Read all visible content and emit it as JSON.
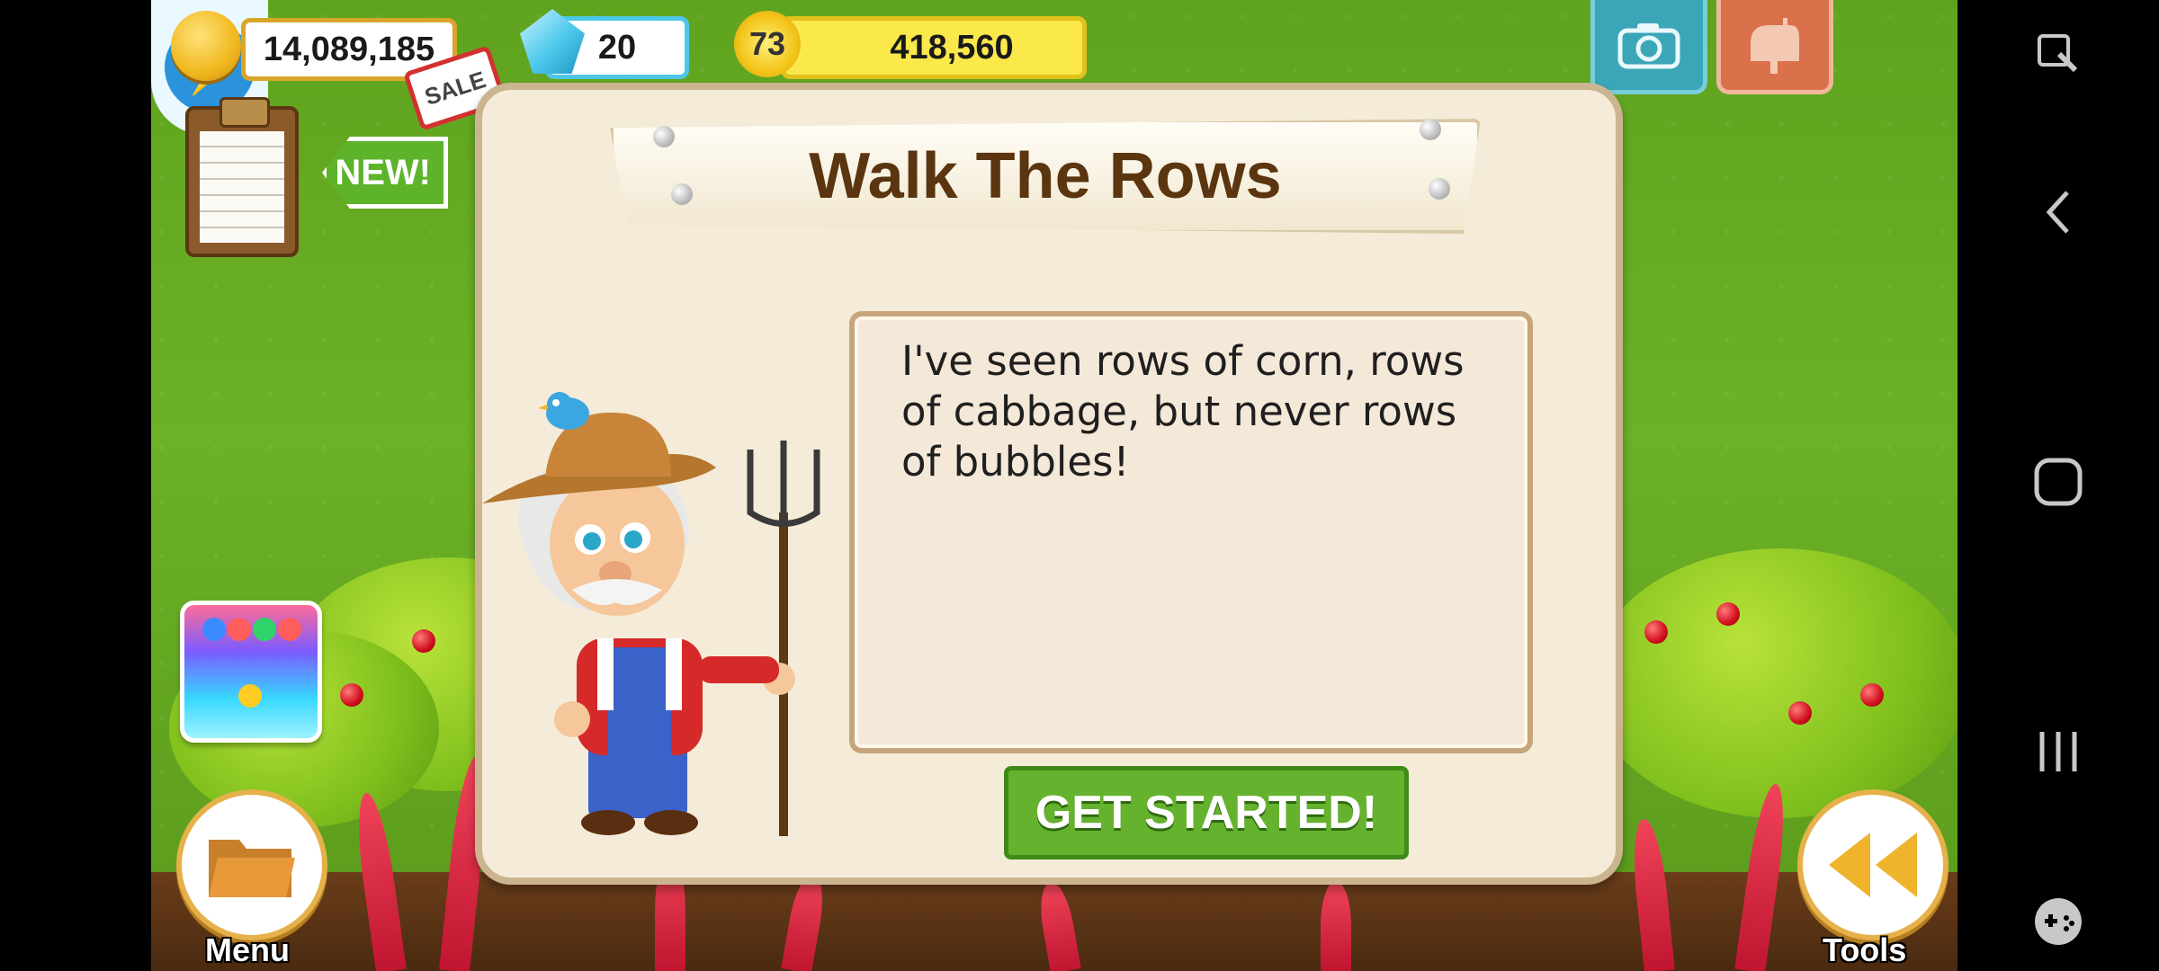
{
  "hud": {
    "coins": "14,089,185",
    "gems": "20",
    "level": "73",
    "xp": "418,560"
  },
  "badges": {
    "sale": "SALE",
    "new": "NEW!"
  },
  "dialog": {
    "title": "Walk The Rows",
    "message": "I've seen rows of corn, rows of cabbage, but never rows of bubbles!",
    "button": "GET STARTED!"
  },
  "bottom": {
    "menu_label": "Menu",
    "tools_label": "Tools"
  },
  "colors": {
    "dialog_bg": "#f4ecd8",
    "button_green": "#65b22e",
    "title_brown": "#5a3510"
  },
  "icons": {
    "camera": "camera-icon",
    "mail": "mailbox-icon",
    "energy": "energy-icon",
    "folder": "folder-icon",
    "rewind": "rewind-icon"
  }
}
